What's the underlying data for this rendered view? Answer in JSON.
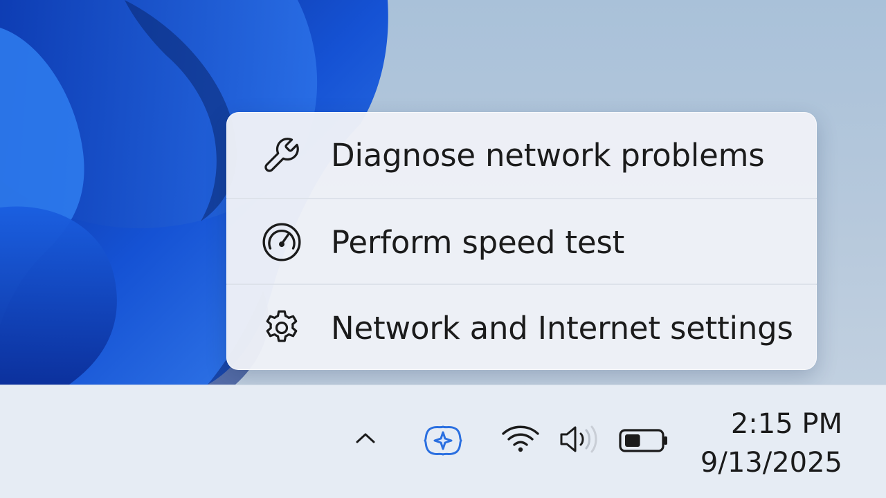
{
  "context_menu": {
    "items": [
      {
        "label": "Diagnose network problems",
        "icon": "wrench-icon"
      },
      {
        "label": "Perform speed test",
        "icon": "speedometer-icon"
      },
      {
        "label": "Network and Internet settings",
        "icon": "gear-icon"
      }
    ]
  },
  "taskbar": {
    "tray_icons": [
      "chevron-up-icon",
      "copilot-icon",
      "wifi-icon",
      "volume-icon",
      "battery-icon"
    ],
    "battery_level": 0.45,
    "clock": {
      "time": "2:15 PM",
      "date": "9/13/2025"
    }
  },
  "colors": {
    "wallpaper_blue": "#1f5fd6",
    "copilot_blue": "#2a6fe0",
    "menu_background": "#eef1f7",
    "taskbar_background": "#e6ecf4"
  }
}
